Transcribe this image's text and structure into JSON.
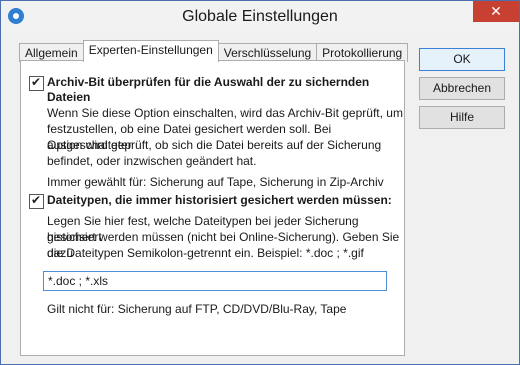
{
  "window": {
    "title": "Globale Einstellungen",
    "close_glyph": "✕"
  },
  "tabs": [
    {
      "label": "Allgemein"
    },
    {
      "label": "Experten-Einstellungen"
    },
    {
      "label": "Verschlüsselung"
    },
    {
      "label": "Protokollierung"
    }
  ],
  "section1": {
    "checkbox_label_line1": "Archiv-Bit überprüfen für die Auswahl der zu sichernden",
    "checkbox_label_line2": "Dateien",
    "desc_line1": "Wenn Sie diese Option einschalten, wird das Archiv-Bit geprüft, um",
    "desc_line2": "festzustellen, ob eine Datei gesichert werden soll. Bei ausgeschalteter",
    "desc_line3": "Option wird geprüft, ob sich die Datei bereits auf der Sicherung",
    "desc_line4": "befindet, oder inzwischen geändert hat.",
    "note": "Immer gewählt für: Sicherung auf Tape, Sicherung in Zip-Archiv"
  },
  "section2": {
    "checkbox_label": "Dateitypen, die immer historisiert gesichert werden müssen:",
    "desc_line1": "Legen Sie hier fest, welche Dateitypen bei jeder Sicherung historisiert",
    "desc_line2": "gesichert werden müssen (nicht bei Online-Sicherung). Geben Sie dazu",
    "desc_line3": "die Dateitypen Semikolon-getrennt ein. Beispiel: *.doc ; *.gif",
    "input_value": "*.doc ; *.xls",
    "note": "Gilt nicht für: Sicherung auf FTP, CD/DVD/Blu-Ray, Tape"
  },
  "buttons": {
    "ok": "OK",
    "cancel": "Abbrechen",
    "help": "Hilfe"
  },
  "icons": {
    "app": "settings-gear-icon",
    "close": "close-icon",
    "checkbox": "checkmark-icon"
  }
}
